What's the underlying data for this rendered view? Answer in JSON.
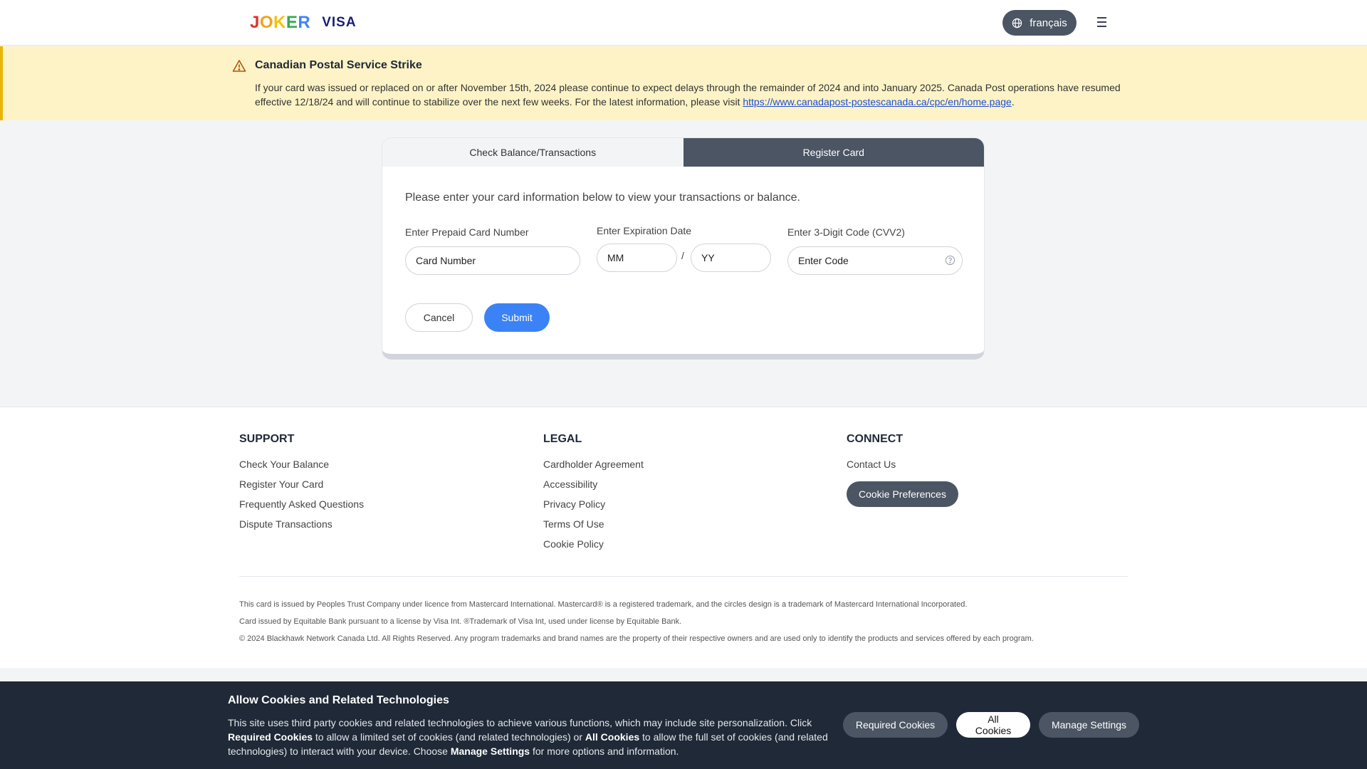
{
  "header": {
    "logo_letters": [
      "J",
      "O",
      "K",
      "E",
      "R"
    ],
    "logo_visa": "VISA",
    "language_label": "français"
  },
  "alert": {
    "title": "Canadian Postal Service Strike",
    "body": "If your card was issued or replaced on or after November 15th, 2024 please continue to expect delays through the remainder of 2024 and into January 2025. Canada Post operations have resumed effective 12/18/24 and will continue to stabilize over the next few weeks. For the latest information, please visit ",
    "link_text": "https://www.canadapost-postescanada.ca/cpc/en/home.page",
    "trailing": "."
  },
  "card_form": {
    "tabs": [
      {
        "label": "Check Balance/Transactions",
        "active": false
      },
      {
        "label": "Register Card",
        "active": true
      }
    ],
    "intro": "Please enter your card information below to view your transactions or balance.",
    "card_number_label": "Enter Prepaid Card Number",
    "card_number_placeholder": "Card Number",
    "expiration_label": "Enter Expiration Date",
    "month_placeholder": "MM",
    "separator": "/",
    "year_placeholder": "YY",
    "cvv_label": "Enter 3-Digit Code (CVV2)",
    "cvv_placeholder": "Enter Code",
    "cancel_label": "Cancel",
    "submit_label": "Submit"
  },
  "footer": {
    "support": {
      "heading": "SUPPORT",
      "links": [
        "Check Your Balance",
        "Register Your Card",
        "Frequently Asked Questions",
        "Dispute Transactions"
      ]
    },
    "legal": {
      "heading": "LEGAL",
      "links": [
        "Cardholder Agreement",
        "Accessibility",
        "Privacy Policy",
        "Terms Of Use",
        "Cookie Policy"
      ]
    },
    "connect": {
      "heading": "CONNECT",
      "links": [
        "Contact Us"
      ],
      "cookie_button": "Cookie Preferences"
    },
    "legal_lines": [
      "This card is issued by Peoples Trust Company under licence from Mastercard International. Mastercard® is a registered trademark, and the circles design is a trademark of Mastercard International Incorporated.",
      "Card issued by Equitable Bank pursuant to a license by Visa Int. ®Trademark of Visa Int, used under license by Equitable Bank.",
      "© 2024 Blackhawk Network Canada Ltd. All Rights Reserved. Any program trademarks and brand names are the property of their respective owners and are used only to identify the products and services offered by each program."
    ]
  },
  "cookie_banner": {
    "title": "Allow Cookies and Related Technologies",
    "text_1": "This site uses third party cookies and related technologies to achieve various functions, which may include site personalization. Click ",
    "bold_required": "Required Cookies",
    "text_2": " to allow a limited set of cookies (and related technologies) or ",
    "bold_all": "All Cookies",
    "text_3": " to allow the full set of cookies (and related technologies) to interact with your device. Choose ",
    "bold_manage": "Manage Settings",
    "text_4": " for more options and information.",
    "buttons": {
      "required": "Required Cookies",
      "all": "All Cookies",
      "manage": "Manage Settings"
    }
  },
  "colors": {
    "primary": "#3b82f6",
    "dark_button": "#4b5563",
    "alert_bg": "#fdf3c6",
    "alert_border": "#eab308",
    "banner_bg": "#1f2937"
  },
  "icons": [
    "globe-icon",
    "menu-icon",
    "warning-icon",
    "help-circle-icon"
  ]
}
